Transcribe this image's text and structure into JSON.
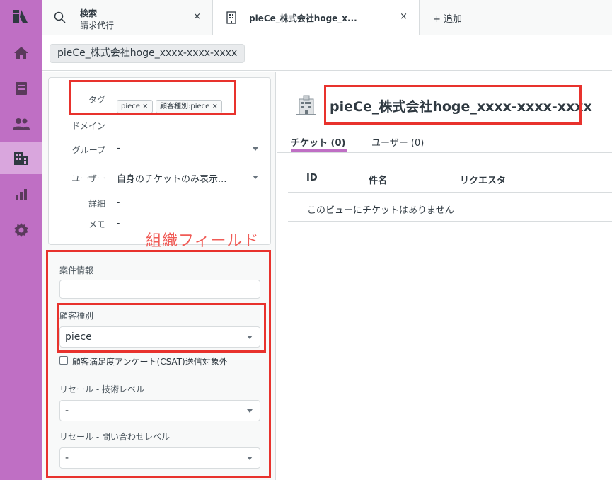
{
  "colors": {
    "sidebar": "#bf6fc4",
    "sidebar_active": "#d9a6dd",
    "annotation_red": "#e8322d",
    "tab_underline": "#bf6fc4"
  },
  "sidebar": {
    "items": [
      {
        "icon": "logo-icon"
      },
      {
        "icon": "home-icon"
      },
      {
        "icon": "views-icon"
      },
      {
        "icon": "customers-icon"
      },
      {
        "icon": "organizations-icon",
        "active": true
      },
      {
        "icon": "reporting-icon"
      },
      {
        "icon": "settings-icon"
      }
    ]
  },
  "tabs": {
    "search": {
      "title": "検索",
      "subtitle": "請求代行",
      "close": "×"
    },
    "org": {
      "title": "pieCe_株式会社hoge_x...",
      "close": "×"
    },
    "add": "+ 追加"
  },
  "breadcrumb": "pieCe_株式会社hoge_xxxx-xxxx-xxxx",
  "org_card": {
    "tag_label": "タグ",
    "tags": [
      "piece ×",
      "顧客種別:piece ×"
    ],
    "domain_label": "ドメイン",
    "domain_value": "-",
    "group_label": "グループ",
    "group_value": "-",
    "user_label": "ユーザー",
    "user_value": "自身のチケットのみ表示...",
    "detail_label": "詳細",
    "detail_value": "-",
    "memo_label": "メモ",
    "memo_value": "-"
  },
  "annotation": "組織フィールド",
  "fields": {
    "case_info_label": "案件情報",
    "case_info_value": "",
    "customer_type_label": "顧客種別",
    "customer_type_value": "piece",
    "csat_label": "顧客満足度アンケート(CSAT)送信対象外",
    "csat_checked": false,
    "resale_tech_label": "リセール - 技術レベル",
    "resale_tech_value": "-",
    "resale_inquiry_label": "リセール - 問い合わせレベル",
    "resale_inquiry_value": "-"
  },
  "main": {
    "org_name": "pieCe_株式会社hoge_xxxx-xxxx-xxxx",
    "tab_tickets": "チケット (0)",
    "tab_users": "ユーザー (0)",
    "col_id": "ID",
    "col_subject": "件名",
    "col_requester": "リクエスタ",
    "empty_message": "このビューにチケットはありません"
  }
}
